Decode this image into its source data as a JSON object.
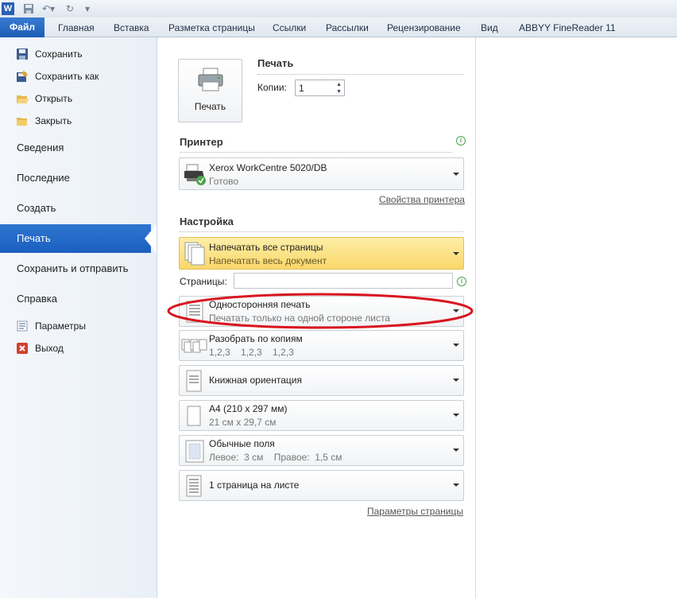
{
  "titlebar": {
    "app_icon": "word-icon",
    "quick_access": [
      "save-icon",
      "undo-icon",
      "redo-icon",
      "customize-icon"
    ]
  },
  "ribbon": {
    "file_tab": "Файл",
    "tabs": [
      "Главная",
      "Вставка",
      "Разметка страницы",
      "Ссылки",
      "Рассылки",
      "Рецензирование",
      "Вид",
      "ABBYY FineReader 11"
    ]
  },
  "leftnav": {
    "top_items": [
      {
        "label": "Сохранить",
        "icon": "save-icon"
      },
      {
        "label": "Сохранить как",
        "icon": "save-as-icon"
      },
      {
        "label": "Открыть",
        "icon": "open-folder-icon"
      },
      {
        "label": "Закрыть",
        "icon": "close-folder-icon"
      }
    ],
    "sections": [
      "Сведения",
      "Последние",
      "Создать",
      "Печать",
      "Сохранить и отправить",
      "Справка"
    ],
    "selected": "Печать",
    "bottom_items": [
      {
        "label": "Параметры",
        "icon": "options-icon"
      },
      {
        "label": "Выход",
        "icon": "exit-icon"
      }
    ]
  },
  "print": {
    "section_title": "Печать",
    "button_label": "Печать",
    "copies_label": "Копии:",
    "copies_value": "1"
  },
  "printer": {
    "section_title": "Принтер",
    "name": "Xerox WorkCentre 5020/DB",
    "status": "Готово",
    "properties_link": "Свойства принтера"
  },
  "settings": {
    "section_title": "Настройка",
    "pages_label": "Страницы:",
    "pages_value": "",
    "options": [
      {
        "title": "Напечатать все страницы",
        "subtitle": "Напечатать весь документ",
        "icon": "pages-icon",
        "highlighted": true
      },
      {
        "title": "Односторонняя печать",
        "subtitle": "Печатать только на одной стороне листа",
        "icon": "one-sided-icon",
        "circled": true
      },
      {
        "title": "Разобрать по копиям",
        "subtitle": "1,2,3    1,2,3    1,2,3",
        "icon": "collate-icon"
      },
      {
        "title": "Книжная ориентация",
        "subtitle": "",
        "icon": "portrait-icon"
      },
      {
        "title": "A4 (210 x 297 мм)",
        "subtitle": "21 см x 29,7 см",
        "icon": "paper-size-icon"
      },
      {
        "title": "Обычные поля",
        "subtitle": "Левое:  3 см    Правое:  1,5 см",
        "icon": "margins-icon"
      },
      {
        "title": "1 страница на листе",
        "subtitle": "",
        "icon": "pages-per-sheet-icon"
      }
    ],
    "page_setup_link": "Параметры страницы"
  },
  "colors": {
    "file_tab": "#2a6cc6",
    "selected_nav": "#2468c6",
    "highlight": "#fbe58b",
    "circle": "#d9151f",
    "info": "#4ca34c"
  }
}
